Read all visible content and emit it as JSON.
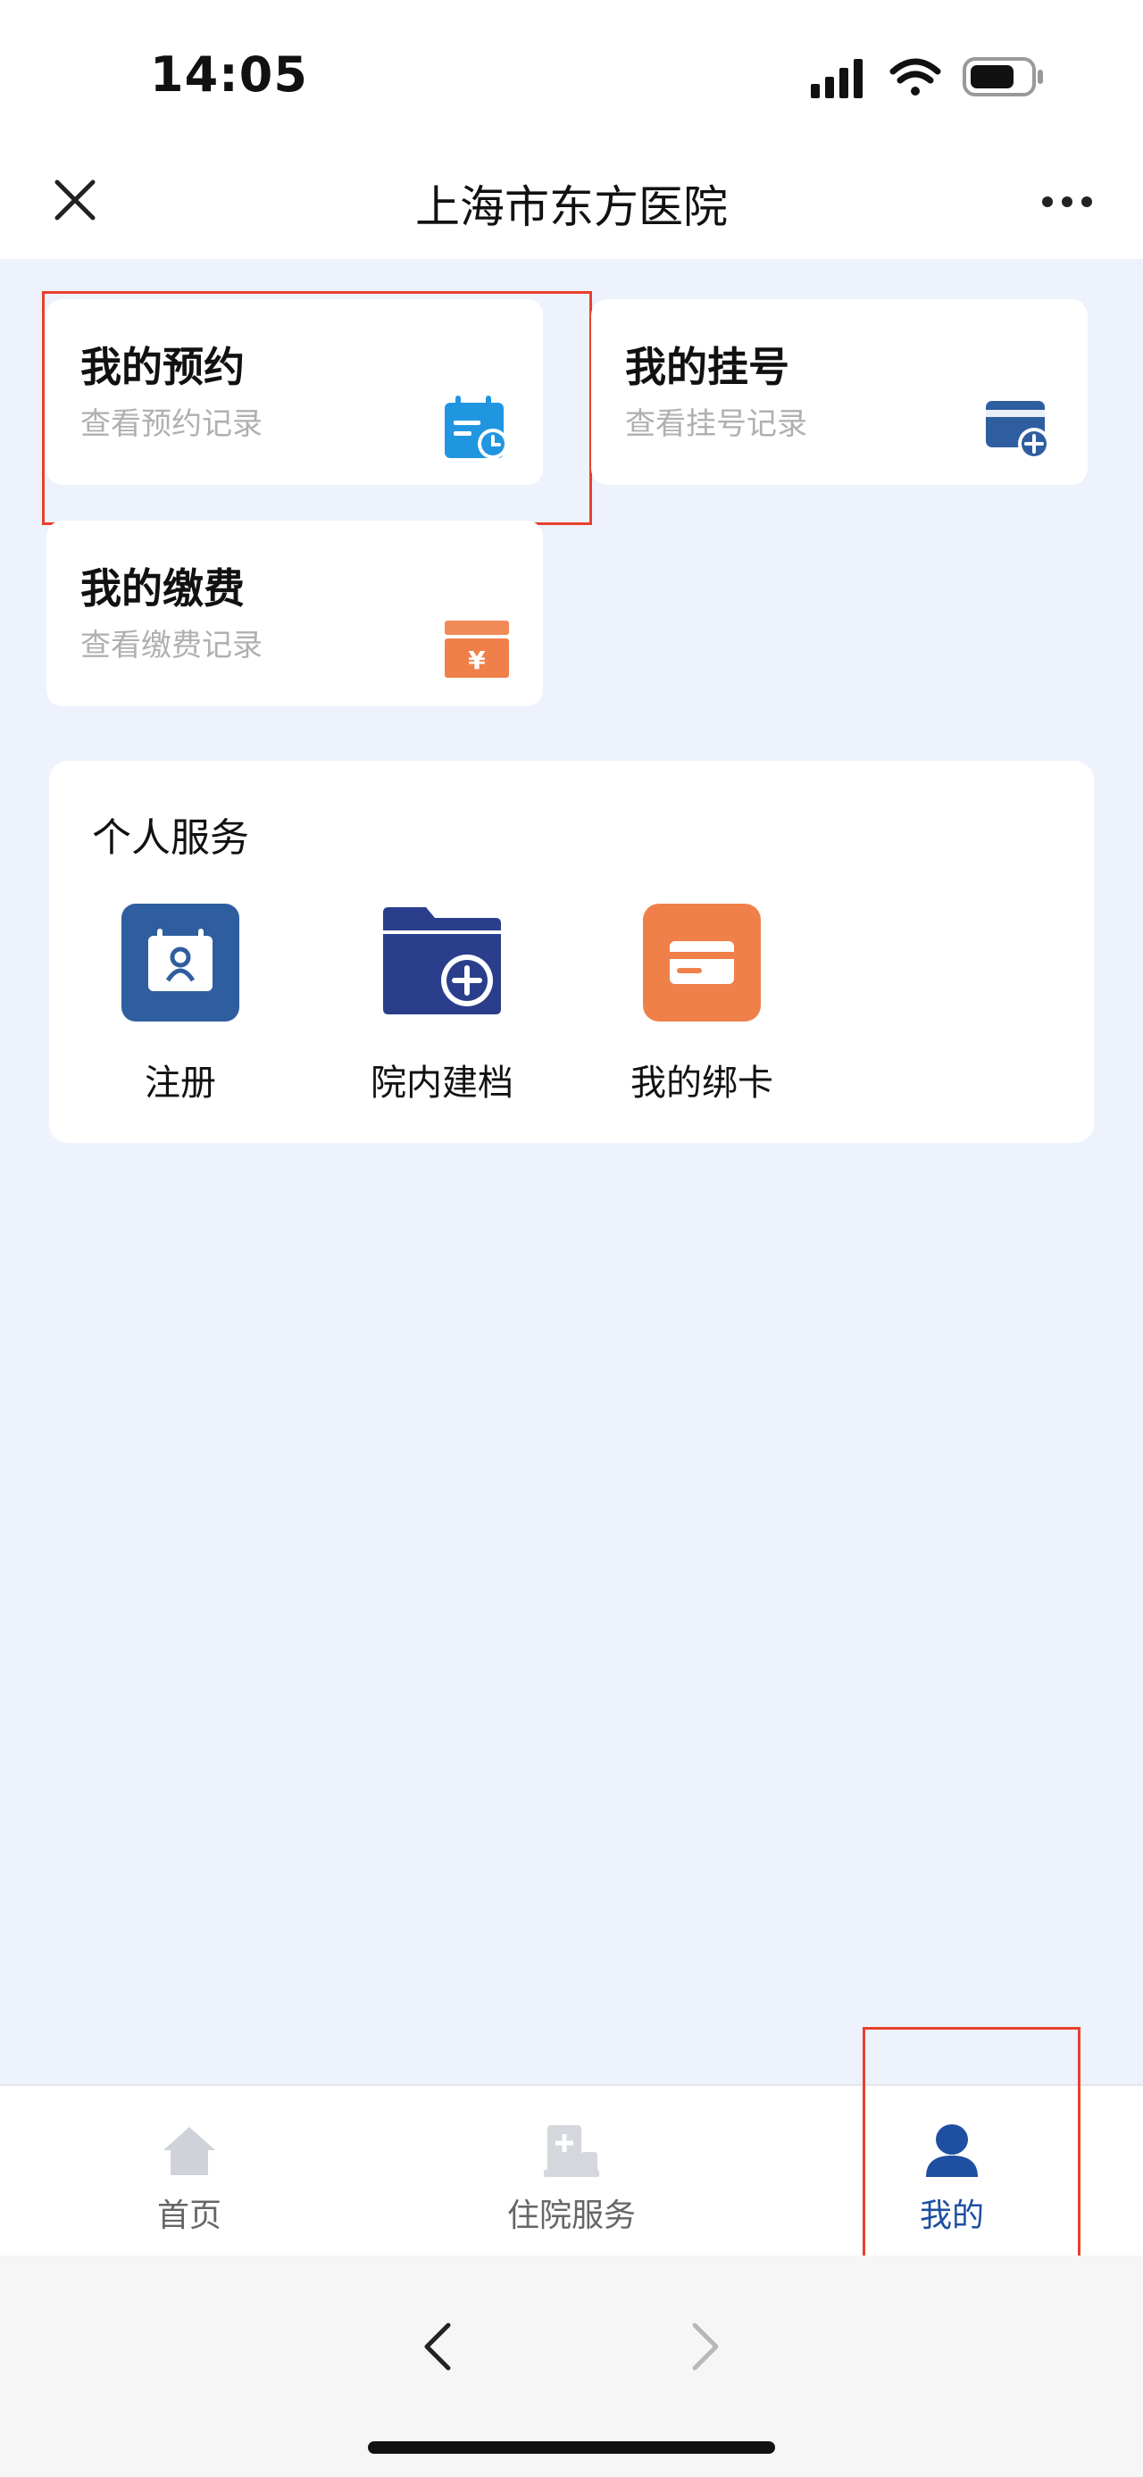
{
  "status": {
    "time": "14:05"
  },
  "nav": {
    "title": "上海市东方医院"
  },
  "cards": [
    {
      "title": "我的预约",
      "subtitle": "查看预约记录",
      "icon": "calendar-clock-icon"
    },
    {
      "title": "我的挂号",
      "subtitle": "查看挂号记录",
      "icon": "card-add-icon"
    },
    {
      "title": "我的缴费",
      "subtitle": "查看缴费记录",
      "icon": "yuan-box-icon"
    }
  ],
  "personal_service": {
    "title": "个人服务",
    "items": [
      {
        "label": "注册",
        "icon": "register-calendar-icon"
      },
      {
        "label": "院内建档",
        "icon": "folder-add-icon"
      },
      {
        "label": "我的绑卡",
        "icon": "bank-card-icon"
      }
    ]
  },
  "tabs": [
    {
      "label": "首页",
      "icon": "home-icon",
      "active": false
    },
    {
      "label": "住院服务",
      "icon": "hospital-bed-icon",
      "active": false
    },
    {
      "label": "我的",
      "icon": "user-icon",
      "active": true
    }
  ],
  "colors": {
    "background": "#edf2fd",
    "accent_blue": "#1e4fa0",
    "icon_blue": "#2f5ea0",
    "icon_light_blue": "#2196e0",
    "icon_orange": "#f0804a",
    "highlight_red": "#e8402e"
  }
}
